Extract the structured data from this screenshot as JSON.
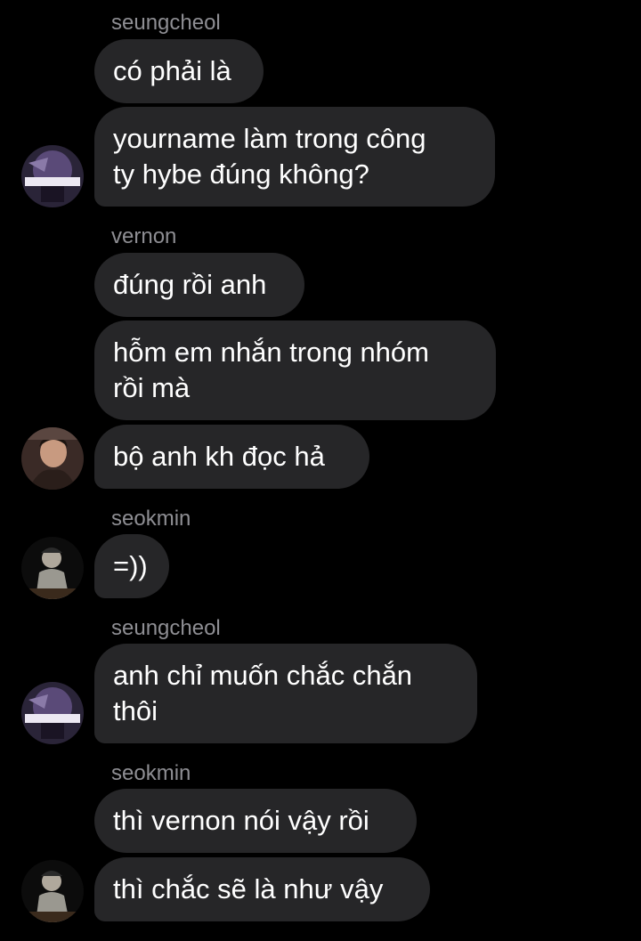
{
  "messages": [
    {
      "sender": "seungcheol",
      "lines": [
        "có phải là"
      ]
    },
    {
      "lines": [
        "yourname làm trong công",
        "ty hybe đúng không?"
      ],
      "avatar": "seungcheol-avatar-icon"
    },
    {
      "sender": "vernon",
      "lines": [
        "đúng rồi anh"
      ]
    },
    {
      "lines": [
        "hỗm em nhắn trong nhóm",
        "rồi mà"
      ]
    },
    {
      "lines": [
        "bộ anh kh đọc hả"
      ],
      "avatar": "vernon-avatar-icon"
    },
    {
      "sender": "seokmin",
      "lines": [
        "=))"
      ],
      "avatar": "seokmin-avatar-icon"
    },
    {
      "sender": "seungcheol",
      "lines": [
        "anh chỉ muốn chắc chắn",
        "thôi"
      ],
      "avatar": "seungcheol-avatar-icon"
    },
    {
      "sender": "seokmin",
      "lines": [
        "thì vernon nói vậy rồi"
      ]
    },
    {
      "lines": [
        "thì chắc sẽ là như vậy"
      ],
      "avatar": "seokmin-avatar-icon"
    }
  ],
  "colors": {
    "background": "#000000",
    "bubble": "#262628",
    "sender_text": "#8e8e93",
    "message_text": "#ffffff"
  }
}
